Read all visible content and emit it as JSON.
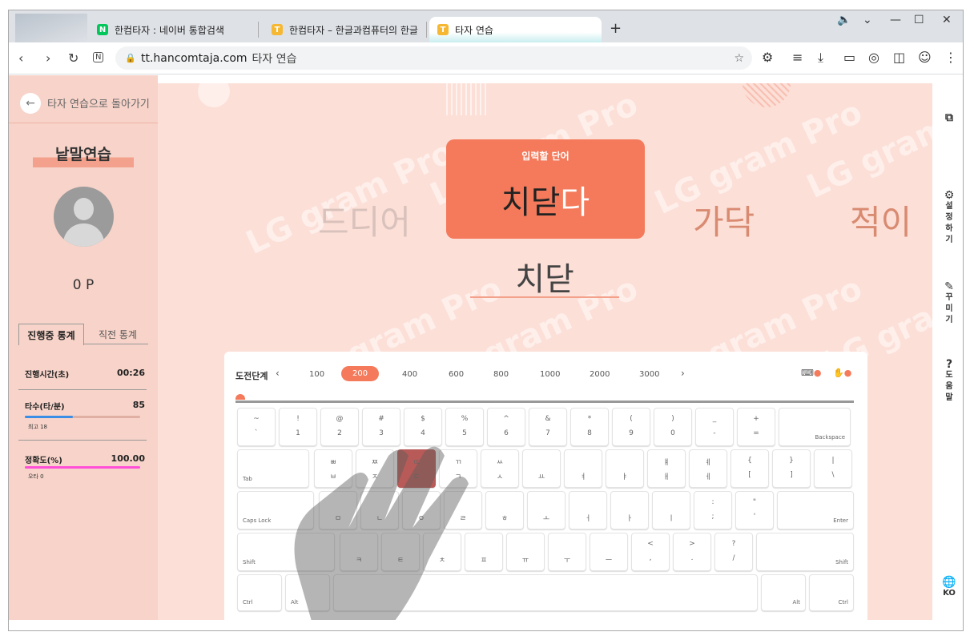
{
  "browser": {
    "tabs": [
      {
        "title": "한컴타자 : 네이버 통합검색",
        "favicon": "N",
        "color": "#03c75a"
      },
      {
        "title": "한컴타자 – 한글과컴퓨터의 한글",
        "favicon": "T",
        "color": "#f6b833"
      },
      {
        "title": "타자 연습",
        "favicon": "T",
        "color": "#f6b833"
      }
    ],
    "url_host": "tt.hancomtaja.com",
    "url_title": "타자 연습"
  },
  "sidebar": {
    "back_label": "타자 연습으로 돌아가기",
    "mode_title": "낱말연습",
    "points": "0 P",
    "tabs": [
      "진행중 통계",
      "직전 통계"
    ],
    "stats": [
      {
        "label": "진행시간(초)",
        "value": "00:26"
      },
      {
        "label": "타수(타/분)",
        "value": "85",
        "sub": "최고 18",
        "bar_fraction": 0.42,
        "bar_color": "#3a8ee6"
      },
      {
        "label": "정확도(%)",
        "value": "100.00",
        "sub": "오타 0",
        "bar_fraction": 1.0,
        "bar_color": "#ff4fd8"
      }
    ]
  },
  "practice": {
    "target_label": "입력할 단어",
    "target_typed": "치닫",
    "target_rest": "다",
    "prev_word": "드디어",
    "next_words": [
      "가닥",
      "적이"
    ],
    "typed": "치닫",
    "watermark": "LG gram Pro"
  },
  "keyboard": {
    "stage_label": "도전단계",
    "levels": [
      "100",
      "200",
      "400",
      "600",
      "800",
      "1000",
      "2000",
      "3000"
    ],
    "active_level": "200",
    "rows": [
      [
        [
          "~",
          "`"
        ],
        [
          "!",
          "1"
        ],
        [
          "@",
          "2"
        ],
        [
          "#",
          "3"
        ],
        [
          "$",
          "4"
        ],
        [
          "%",
          "5"
        ],
        [
          "^",
          "6"
        ],
        [
          "&",
          "7"
        ],
        [
          "*",
          "8"
        ],
        [
          "(",
          "9"
        ],
        [
          ")",
          "0"
        ],
        [
          "_",
          "-"
        ],
        [
          "+",
          "="
        ]
      ],
      [
        [
          "ㅃ",
          "ㅂ"
        ],
        [
          "ㅉ",
          "ㅈ"
        ],
        [
          "ㄸ",
          "ㄷ"
        ],
        [
          "ㄲ",
          "ㄱ"
        ],
        [
          "ㅆ",
          "ㅅ"
        ],
        [
          "",
          "ㅛ"
        ],
        [
          "",
          "ㅕ"
        ],
        [
          "",
          "ㅑ"
        ],
        [
          "ㅒ",
          "ㅐ"
        ],
        [
          "ㅖ",
          "ㅔ"
        ],
        [
          "{",
          "["
        ],
        [
          "}",
          "]"
        ],
        [
          "|",
          "\\"
        ]
      ],
      [
        [
          "",
          "ㅁ"
        ],
        [
          "",
          "ㄴ"
        ],
        [
          "",
          "ㅇ"
        ],
        [
          "",
          "ㄹ"
        ],
        [
          "",
          "ㅎ"
        ],
        [
          "",
          "ㅗ"
        ],
        [
          "",
          "ㅓ"
        ],
        [
          "",
          "ㅏ"
        ],
        [
          "",
          "ㅣ"
        ],
        [
          ":",
          ";"
        ],
        [
          "\"",
          "'"
        ]
      ],
      [
        [
          "",
          "ㅋ"
        ],
        [
          "",
          "ㅌ"
        ],
        [
          "",
          "ㅊ"
        ],
        [
          "",
          "ㅍ"
        ],
        [
          "",
          "ㅠ"
        ],
        [
          "",
          "ㅜ"
        ],
        [
          "",
          "ㅡ"
        ],
        [
          "<",
          ","
        ],
        [
          ">",
          "."
        ],
        [
          "?",
          "/"
        ]
      ]
    ],
    "special": {
      "backspace": "Backspace",
      "tab": "Tab",
      "caps": "Caps Lock",
      "enter": "Enter",
      "shift": "Shift",
      "ctrl": "Ctrl",
      "alt": "Alt"
    },
    "highlight_key": "ㄷ"
  },
  "right_sidebar": {
    "items": [
      "설정하기",
      "꾸미기",
      "도움말"
    ],
    "lang": "KO"
  },
  "colors": {
    "accent": "#f47a5b",
    "sidebar": "#f7d3c9",
    "main_bg": "#fcdfd7"
  }
}
